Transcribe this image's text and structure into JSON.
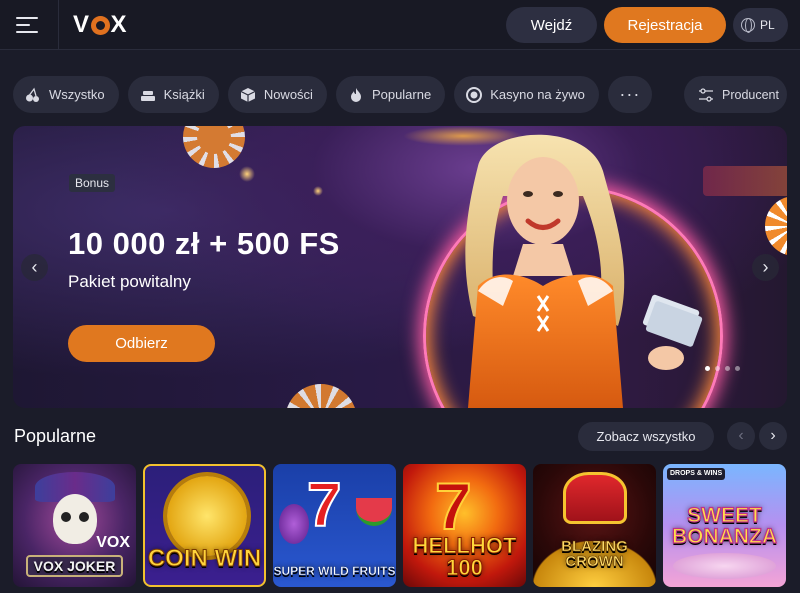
{
  "header": {
    "logo_text": "VOX",
    "login_label": "Wejdź",
    "register_label": "Rejestracja",
    "language": "PL"
  },
  "categories": [
    {
      "label": "Wszystko",
      "icon": "cherry-icon"
    },
    {
      "label": "Książki",
      "icon": "stack-icon"
    },
    {
      "label": "Nowości",
      "icon": "cube-icon"
    },
    {
      "label": "Popularne",
      "icon": "flame-icon"
    },
    {
      "label": "Kasyno na żywo",
      "icon": "chip-icon"
    },
    {
      "label": "···",
      "icon": "more-icon"
    }
  ],
  "filter": {
    "producer_label": "Producent",
    "icon": "sliders-icon"
  },
  "banner": {
    "badge": "Bonus",
    "title": "10 000 zł + 500 FS",
    "subtitle": "Pakiet powitalny",
    "cta_label": "Odbierz",
    "prev_arrow": "‹",
    "next_arrow": "›",
    "slides_total": 4,
    "active_slide": 1
  },
  "popular": {
    "title": "Popularne",
    "see_all_label": "Zobacz wszystko",
    "prev_arrow": "‹",
    "next_arrow": "›",
    "games": [
      {
        "title": "VOX JOKER",
        "extra": "VOX"
      },
      {
        "title": "COIN WIN",
        "extra": ""
      },
      {
        "title": "SUPER WILD FRUITS",
        "extra": ""
      },
      {
        "title": "HELLHOT 100",
        "extra": ""
      },
      {
        "title": "BLAZING CROWN",
        "extra": ""
      },
      {
        "title": "SWEET BONANZA",
        "extra": "DROPS & WINS"
      }
    ]
  },
  "colors": {
    "accent": "#e0781f",
    "background": "#1b1c29",
    "pill": "#2a2c3c"
  }
}
